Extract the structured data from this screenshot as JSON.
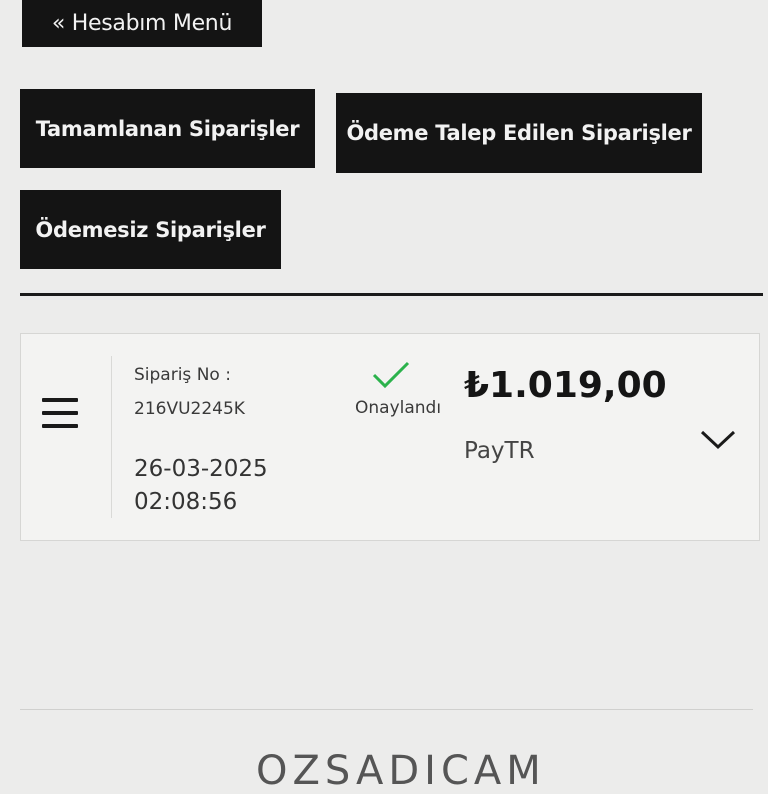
{
  "nav": {
    "back_label": "« Hesabım Menü"
  },
  "tabs": {
    "completed": "Tamamlanan Siparişler",
    "payment_requested": "Ödeme Talep Edilen Siparişler",
    "unpaid": "Ödemesiz Siparişler"
  },
  "order": {
    "label": "Sipariş No :",
    "number": "216VU2245K",
    "date": "26-03-2025",
    "time": "02:08:56",
    "status": "Onaylandı",
    "price": "₺1.019,00",
    "payment_method": "PayTR"
  },
  "footer": {
    "logo_text": "OZSADICAM"
  },
  "colors": {
    "button_bg": "#141414",
    "status_green": "#2bb24c"
  }
}
